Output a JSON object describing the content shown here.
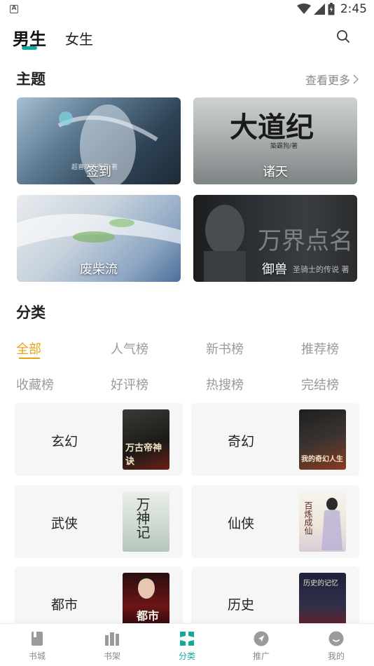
{
  "status_bar": {
    "time": "2:45"
  },
  "top_tabs": {
    "male": "男生",
    "female": "女生"
  },
  "theme_section": {
    "title": "主题",
    "more": "查看更多",
    "cards": [
      {
        "label": "签到",
        "overlay_text": "超喜欢吃香菇 著"
      },
      {
        "label": "诸天",
        "overlay_title": "大道纪",
        "overlay_text": "築霸狗/著"
      },
      {
        "label": "废柴流",
        "overlay_title": "废柴流"
      },
      {
        "label": "御兽",
        "overlay_title": "万界点名",
        "overlay_text": "圣骑士的传说 著"
      }
    ]
  },
  "category_section": {
    "title": "分类",
    "filters": [
      "全部",
      "人气榜",
      "新书榜",
      "推荐榜",
      "收藏榜",
      "好评榜",
      "热搜榜",
      "完结榜"
    ],
    "active_filter": "全部",
    "genres": [
      {
        "name": "玄幻",
        "cover_title": "万古帝神诀"
      },
      {
        "name": "奇幻",
        "cover_title": "我的奇幻人生"
      },
      {
        "name": "武侠",
        "cover_title": "万神记"
      },
      {
        "name": "仙侠",
        "cover_title": "百炼成仙"
      },
      {
        "name": "都市",
        "cover_title": "都市"
      },
      {
        "name": "历史",
        "cover_title": "历史的记忆"
      }
    ]
  },
  "bottom_nav": {
    "items": [
      "书城",
      "书架",
      "分类",
      "推广",
      "我的"
    ],
    "active": "分类"
  },
  "colors": {
    "accent": "#13a89e",
    "filter_active": "#e8a317"
  }
}
